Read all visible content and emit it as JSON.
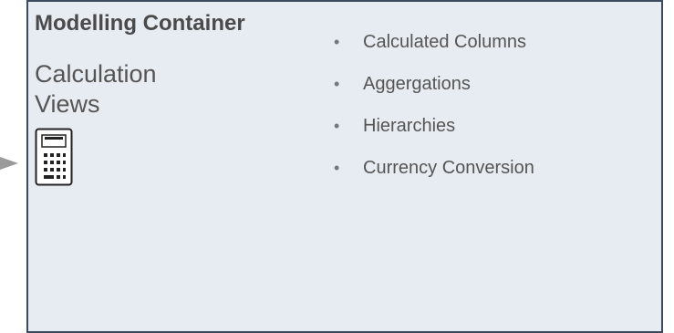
{
  "container": {
    "title": "Modelling Container",
    "subtitle_line1": "Calculation",
    "subtitle_line2": "Views"
  },
  "icons": {
    "calculator": "calculator-icon",
    "arrow": "arrow-right-icon"
  },
  "features": [
    {
      "bullet": "•",
      "label": "Calculated Columns"
    },
    {
      "bullet": "•",
      "label": "Aggergations"
    },
    {
      "bullet": "•",
      "label": "Hierarchies"
    },
    {
      "bullet": "•",
      "label": "Currency Conversion"
    }
  ],
  "colors": {
    "container_fill": "#e7ecf2",
    "container_border": "#3b4a5c",
    "text": "#555555",
    "title_text": "#4a4a4a",
    "arrow": "#9a9a9a"
  }
}
